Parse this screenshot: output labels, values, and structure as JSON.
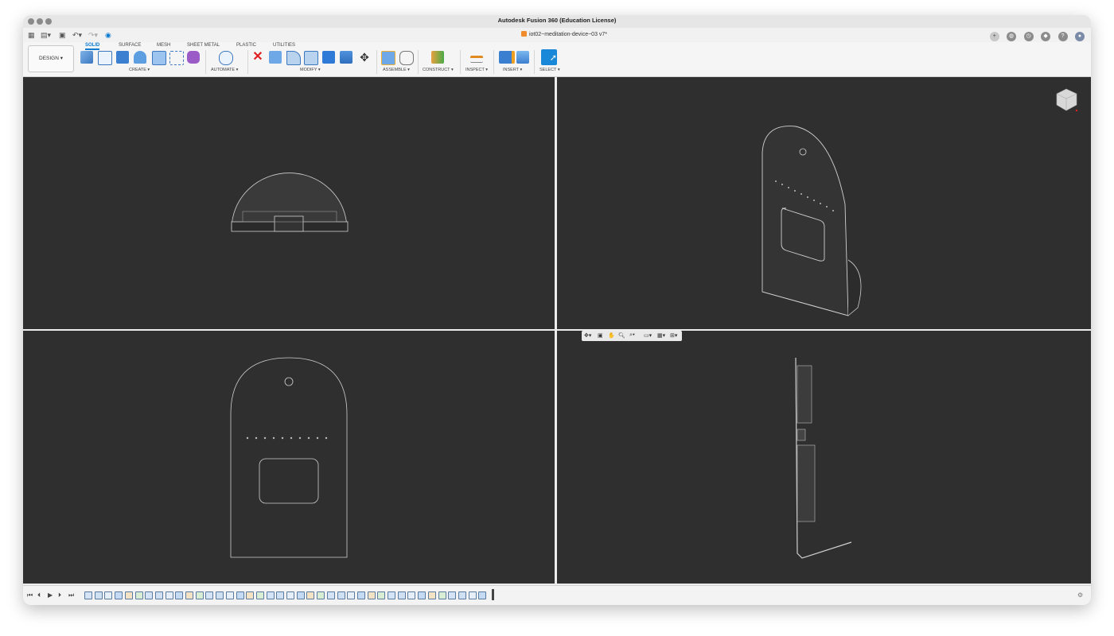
{
  "window": {
    "title": "Autodesk Fusion 360 (Education License)"
  },
  "document_tab": {
    "name": "iot02~meditation-device~03 v7*",
    "close": "×"
  },
  "workspace": {
    "label": "DESIGN ▾"
  },
  "ribbon_tabs": [
    "SOLID",
    "SURFACE",
    "MESH",
    "SHEET METAL",
    "PLASTIC",
    "UTILITIES"
  ],
  "active_tab": "SOLID",
  "groups": {
    "create": "CREATE ▾",
    "automate": "AUTOMATE ▾",
    "modify": "MODIFY ▾",
    "assemble": "ASSEMBLE ▾",
    "construct": "CONSTRUCT ▾",
    "inspect": "INSPECT ▾",
    "insert": "INSERT ▾",
    "select": "SELECT ▾"
  },
  "icons": {
    "grid": "grid-menu-icon",
    "file": "file-icon",
    "save": "save-icon",
    "undo": "undo-icon",
    "redo": "redo-icon",
    "playback_first": "⏮",
    "playback_prev": "⏴",
    "playback_play": "▶",
    "playback_next": "⏵",
    "playback_last": "⏭",
    "settings": "⚙"
  },
  "colors": {
    "accent": "#0a7bd1",
    "viewport_bg": "#2f2f2f",
    "delete_red": "#e02020",
    "doc_orange": "#f08c2a"
  }
}
